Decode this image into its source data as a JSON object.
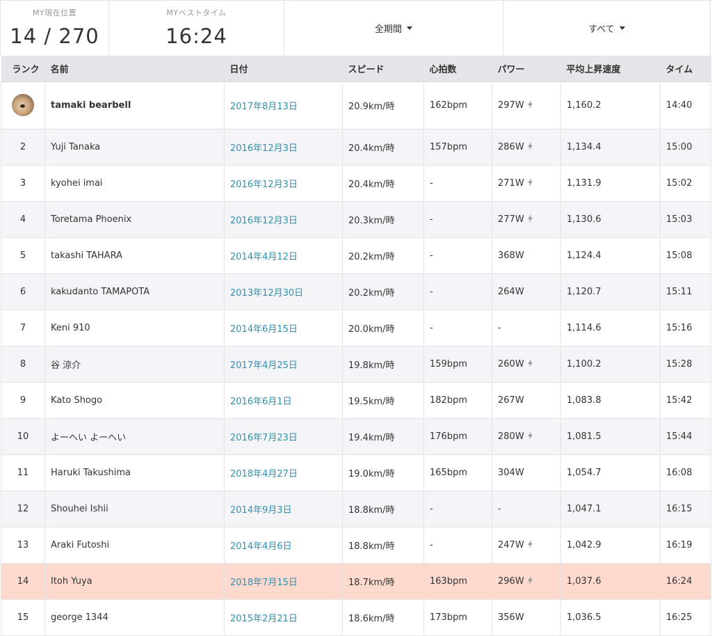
{
  "summary": {
    "position_label": "MY現在位置",
    "position_value": "14 / 270",
    "best_label": "MYベストタイム",
    "best_value": "16:24",
    "period_filter": "全期間",
    "category_filter": "すべて"
  },
  "columns": {
    "rank": "ランク",
    "name": "名前",
    "date": "日付",
    "speed": "スピード",
    "hr": "心拍数",
    "power": "パワー",
    "vam": "平均上昇速度",
    "time": "タイム"
  },
  "colors": {
    "link": "#2f8fb0",
    "highlight_row": "#fddacd",
    "header_bg": "#e6e6e9"
  },
  "rows": [
    {
      "rank": "",
      "avatar": true,
      "name": "tamaki bearbell",
      "date": "2017年8月13日",
      "speed": "20.9km/時",
      "hr": "162bpm",
      "power": "297W",
      "power_meter": true,
      "vam": "1,160.2",
      "time": "14:40"
    },
    {
      "rank": "2",
      "name": "Yuji Tanaka",
      "date": "2016年12月3日",
      "speed": "20.4km/時",
      "hr": "157bpm",
      "power": "286W",
      "power_meter": true,
      "vam": "1,134.4",
      "time": "15:00"
    },
    {
      "rank": "3",
      "name": "kyohei imai",
      "date": "2016年12月3日",
      "speed": "20.4km/時",
      "hr": "-",
      "power": "271W",
      "power_meter": true,
      "vam": "1,131.9",
      "time": "15:02"
    },
    {
      "rank": "4",
      "name": "Toretama Phoenix",
      "date": "2016年12月3日",
      "speed": "20.3km/時",
      "hr": "-",
      "power": "277W",
      "power_meter": true,
      "vam": "1,130.6",
      "time": "15:03"
    },
    {
      "rank": "5",
      "name": "takashi TAHARA",
      "date": "2014年4月12日",
      "speed": "20.2km/時",
      "hr": "-",
      "power": "368W",
      "power_meter": false,
      "vam": "1,124.4",
      "time": "15:08"
    },
    {
      "rank": "6",
      "name": "kakudanto TAMAPOTA",
      "date": "2013年12月30日",
      "speed": "20.2km/時",
      "hr": "-",
      "power": "264W",
      "power_meter": false,
      "vam": "1,120.7",
      "time": "15:11"
    },
    {
      "rank": "7",
      "name": "Keni 910",
      "date": "2014年6月15日",
      "speed": "20.0km/時",
      "hr": "-",
      "power": "-",
      "power_meter": false,
      "vam": "1,114.6",
      "time": "15:16"
    },
    {
      "rank": "8",
      "name": "谷 涼介",
      "date": "2017年4月25日",
      "speed": "19.8km/時",
      "hr": "159bpm",
      "power": "260W",
      "power_meter": true,
      "vam": "1,100.2",
      "time": "15:28"
    },
    {
      "rank": "9",
      "name": "Kato Shogo",
      "date": "2016年6月1日",
      "speed": "19.5km/時",
      "hr": "182bpm",
      "power": "267W",
      "power_meter": false,
      "vam": "1,083.8",
      "time": "15:42"
    },
    {
      "rank": "10",
      "name": "よーへい よーへい",
      "date": "2016年7月23日",
      "speed": "19.4km/時",
      "hr": "176bpm",
      "power": "280W",
      "power_meter": true,
      "vam": "1,081.5",
      "time": "15:44"
    },
    {
      "rank": "11",
      "name": "Haruki Takushima",
      "date": "2018年4月27日",
      "speed": "19.0km/時",
      "hr": "165bpm",
      "power": "304W",
      "power_meter": false,
      "vam": "1,054.7",
      "time": "16:08"
    },
    {
      "rank": "12",
      "name": "Shouhei Ishii",
      "date": "2014年9月3日",
      "speed": "18.8km/時",
      "hr": "-",
      "power": "-",
      "power_meter": false,
      "vam": "1,047.1",
      "time": "16:15"
    },
    {
      "rank": "13",
      "name": "Araki Futoshi",
      "date": "2014年4月6日",
      "speed": "18.8km/時",
      "hr": "-",
      "power": "247W",
      "power_meter": true,
      "vam": "1,042.9",
      "time": "16:19"
    },
    {
      "rank": "14",
      "name": "Itoh Yuya",
      "date": "2018年7月15日",
      "speed": "18.7km/時",
      "hr": "163bpm",
      "power": "296W",
      "power_meter": true,
      "vam": "1,037.6",
      "time": "16:24",
      "is_me": true
    },
    {
      "rank": "15",
      "name": "george 1344",
      "date": "2015年2月21日",
      "speed": "18.6km/時",
      "hr": "173bpm",
      "power": "356W",
      "power_meter": false,
      "vam": "1,036.5",
      "time": "16:25"
    }
  ]
}
